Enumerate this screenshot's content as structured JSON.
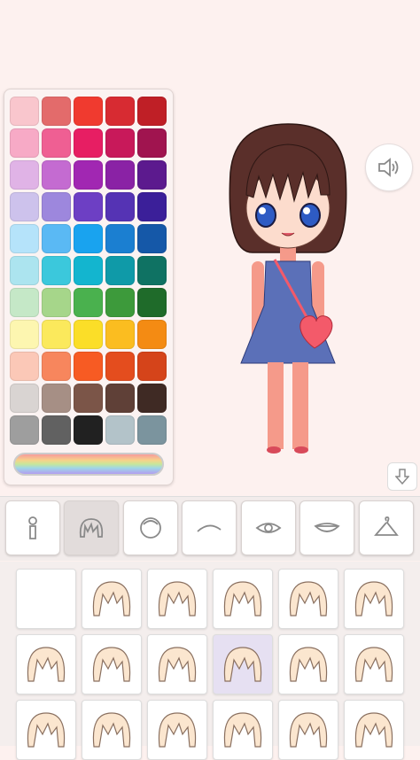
{
  "palette": {
    "rows": [
      [
        "#f9c6cd",
        "#e36b6b",
        "#f03a2f",
        "#d72b32",
        "#bf1f26"
      ],
      [
        "#f7aac6",
        "#ef5f93",
        "#e71e63",
        "#c8195a",
        "#a0144f"
      ],
      [
        "#e0b3e6",
        "#c46bd1",
        "#a127b2",
        "#8a22a5",
        "#5c1a8e"
      ],
      [
        "#cdc2ec",
        "#9d87dd",
        "#6d3fc4",
        "#5533b4",
        "#3b1f99"
      ],
      [
        "#b5e3fa",
        "#5ab9f4",
        "#19a3ef",
        "#1b7fd1",
        "#1558a8"
      ],
      [
        "#ace4ef",
        "#3bc8dc",
        "#13b5cf",
        "#0f9aa8",
        "#0f7263"
      ],
      [
        "#c5e8c7",
        "#a6d68a",
        "#4ab14e",
        "#3d9a3b",
        "#1f6b2a"
      ],
      [
        "#fdf6b0",
        "#fbe95c",
        "#fbde28",
        "#fbbd20",
        "#f48b13"
      ],
      [
        "#fbc8b7",
        "#f7865d",
        "#f75b23",
        "#e44d1e",
        "#d5441a"
      ],
      [
        "#d9d4d2",
        "#a68f85",
        "#7b5548",
        "#5f4037",
        "#3f2a24"
      ],
      [
        "#9e9e9e",
        "#616161",
        "#212121",
        "#b3c3c9",
        "#7b949e"
      ]
    ]
  },
  "colors": {
    "hair": "#5a2f2a",
    "skin": "#f59a8a",
    "dress": "#5b70b8",
    "heart": "#f35a6a",
    "icon": "#8a8a8a"
  },
  "tabs": [
    {
      "icon": "body-icon",
      "active": false
    },
    {
      "icon": "hair-front-icon",
      "active": true
    },
    {
      "icon": "hair-back-icon",
      "active": false
    },
    {
      "icon": "eyebrow-icon",
      "active": false
    },
    {
      "icon": "eye-icon",
      "active": false
    },
    {
      "icon": "mouth-icon",
      "active": false
    },
    {
      "icon": "clothes-hanger-icon",
      "active": false
    }
  ],
  "hair_options": [
    {
      "style": "empty"
    },
    {
      "style": "bob-parted"
    },
    {
      "style": "bob-layered"
    },
    {
      "style": "spiky"
    },
    {
      "style": "messy"
    },
    {
      "style": "wavy-long"
    },
    {
      "style": "hime-bob"
    },
    {
      "style": "curtain"
    },
    {
      "style": "side-swept"
    },
    {
      "style": "classic-bob",
      "selected": true
    },
    {
      "style": "short-messy"
    },
    {
      "style": "tufted"
    },
    {
      "style": "round-bangs"
    },
    {
      "style": "center-part"
    },
    {
      "style": "side-part"
    },
    {
      "style": "straight"
    },
    {
      "style": "fringe"
    },
    {
      "style": "wispy"
    }
  ]
}
